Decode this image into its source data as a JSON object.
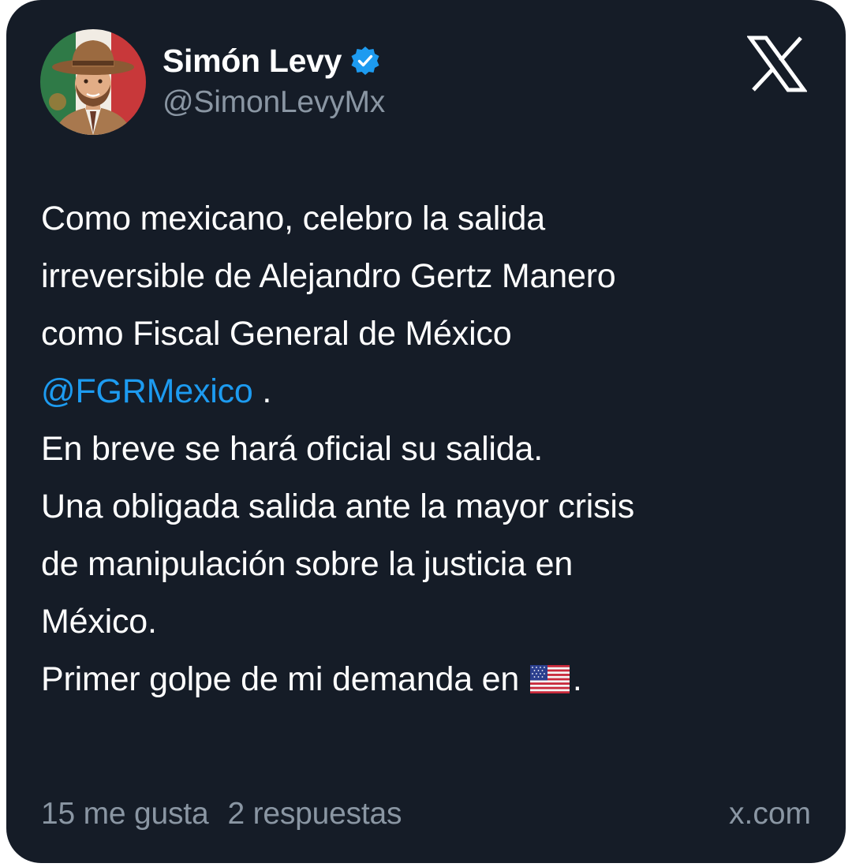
{
  "author": {
    "name": "Simón Levy",
    "handle": "@SimonLevyMx",
    "verified": true,
    "verified_color": "#1d9bf0"
  },
  "platform": {
    "logo": "x-logo-icon"
  },
  "tweet": {
    "line1": "Como mexicano, celebro la salida",
    "line2": "irreversible de Alejandro Gertz Manero",
    "line3": "como Fiscal General de México",
    "mention": "@FGRMexico",
    "mention_suffix": " .",
    "line5": "En breve se hará oficial su salida.",
    "line6": "Una obligada salida ante la mayor crisis",
    "line7": "de manipulación sobre la justicia en",
    "line8": "México.",
    "line9_prefix": "Primer golpe de mi demanda en ",
    "line9_flag": "us-flag-icon",
    "line9_suffix": "."
  },
  "footer": {
    "likes": "15 me gusta",
    "replies": "2 respuestas",
    "domain": "x.com"
  },
  "colors": {
    "card_background": "#151c27",
    "text": "#ffffff",
    "muted": "#8a96a3",
    "link": "#1d9bf0"
  }
}
